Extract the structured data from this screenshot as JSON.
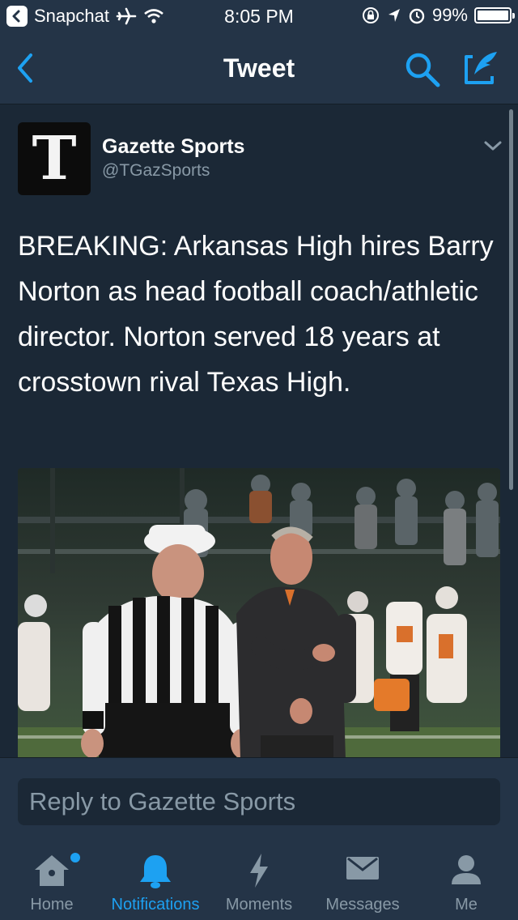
{
  "status_bar": {
    "back_app": "Snapchat",
    "time": "8:05 PM",
    "battery": "99%",
    "battery_level": 0.99,
    "icons": [
      "airplane-icon",
      "wifi-icon",
      "rotation-lock-icon",
      "location-icon",
      "alarm-icon",
      "battery-icon"
    ]
  },
  "nav": {
    "title": "Tweet",
    "back_icon": "chevron-left-icon",
    "search_icon": "search-icon",
    "compose_icon": "compose-icon"
  },
  "tweet": {
    "author_name": "Gazette Sports",
    "author_handle": "@TGazSports",
    "avatar_letter": "T",
    "text": "BREAKING: Arkansas High hires Barry Norton as head football coach/athletic director. Norton served 18 years at crosstown rival Texas High.",
    "menu_icon": "chevron-down-icon"
  },
  "reply": {
    "placeholder": "Reply to Gazette Sports"
  },
  "tabs": [
    {
      "label": "Home",
      "icon": "home-icon",
      "active": false,
      "badge": true
    },
    {
      "label": "Notifications",
      "icon": "bell-icon",
      "active": true,
      "badge": false
    },
    {
      "label": "Moments",
      "icon": "lightning-icon",
      "active": false,
      "badge": false
    },
    {
      "label": "Messages",
      "icon": "envelope-icon",
      "active": false,
      "badge": false
    },
    {
      "label": "Me",
      "icon": "person-icon",
      "active": false,
      "badge": false
    }
  ],
  "colors": {
    "background": "#1b2836",
    "bar": "#243447",
    "accent": "#1da1f2",
    "muted": "#8899a6"
  }
}
